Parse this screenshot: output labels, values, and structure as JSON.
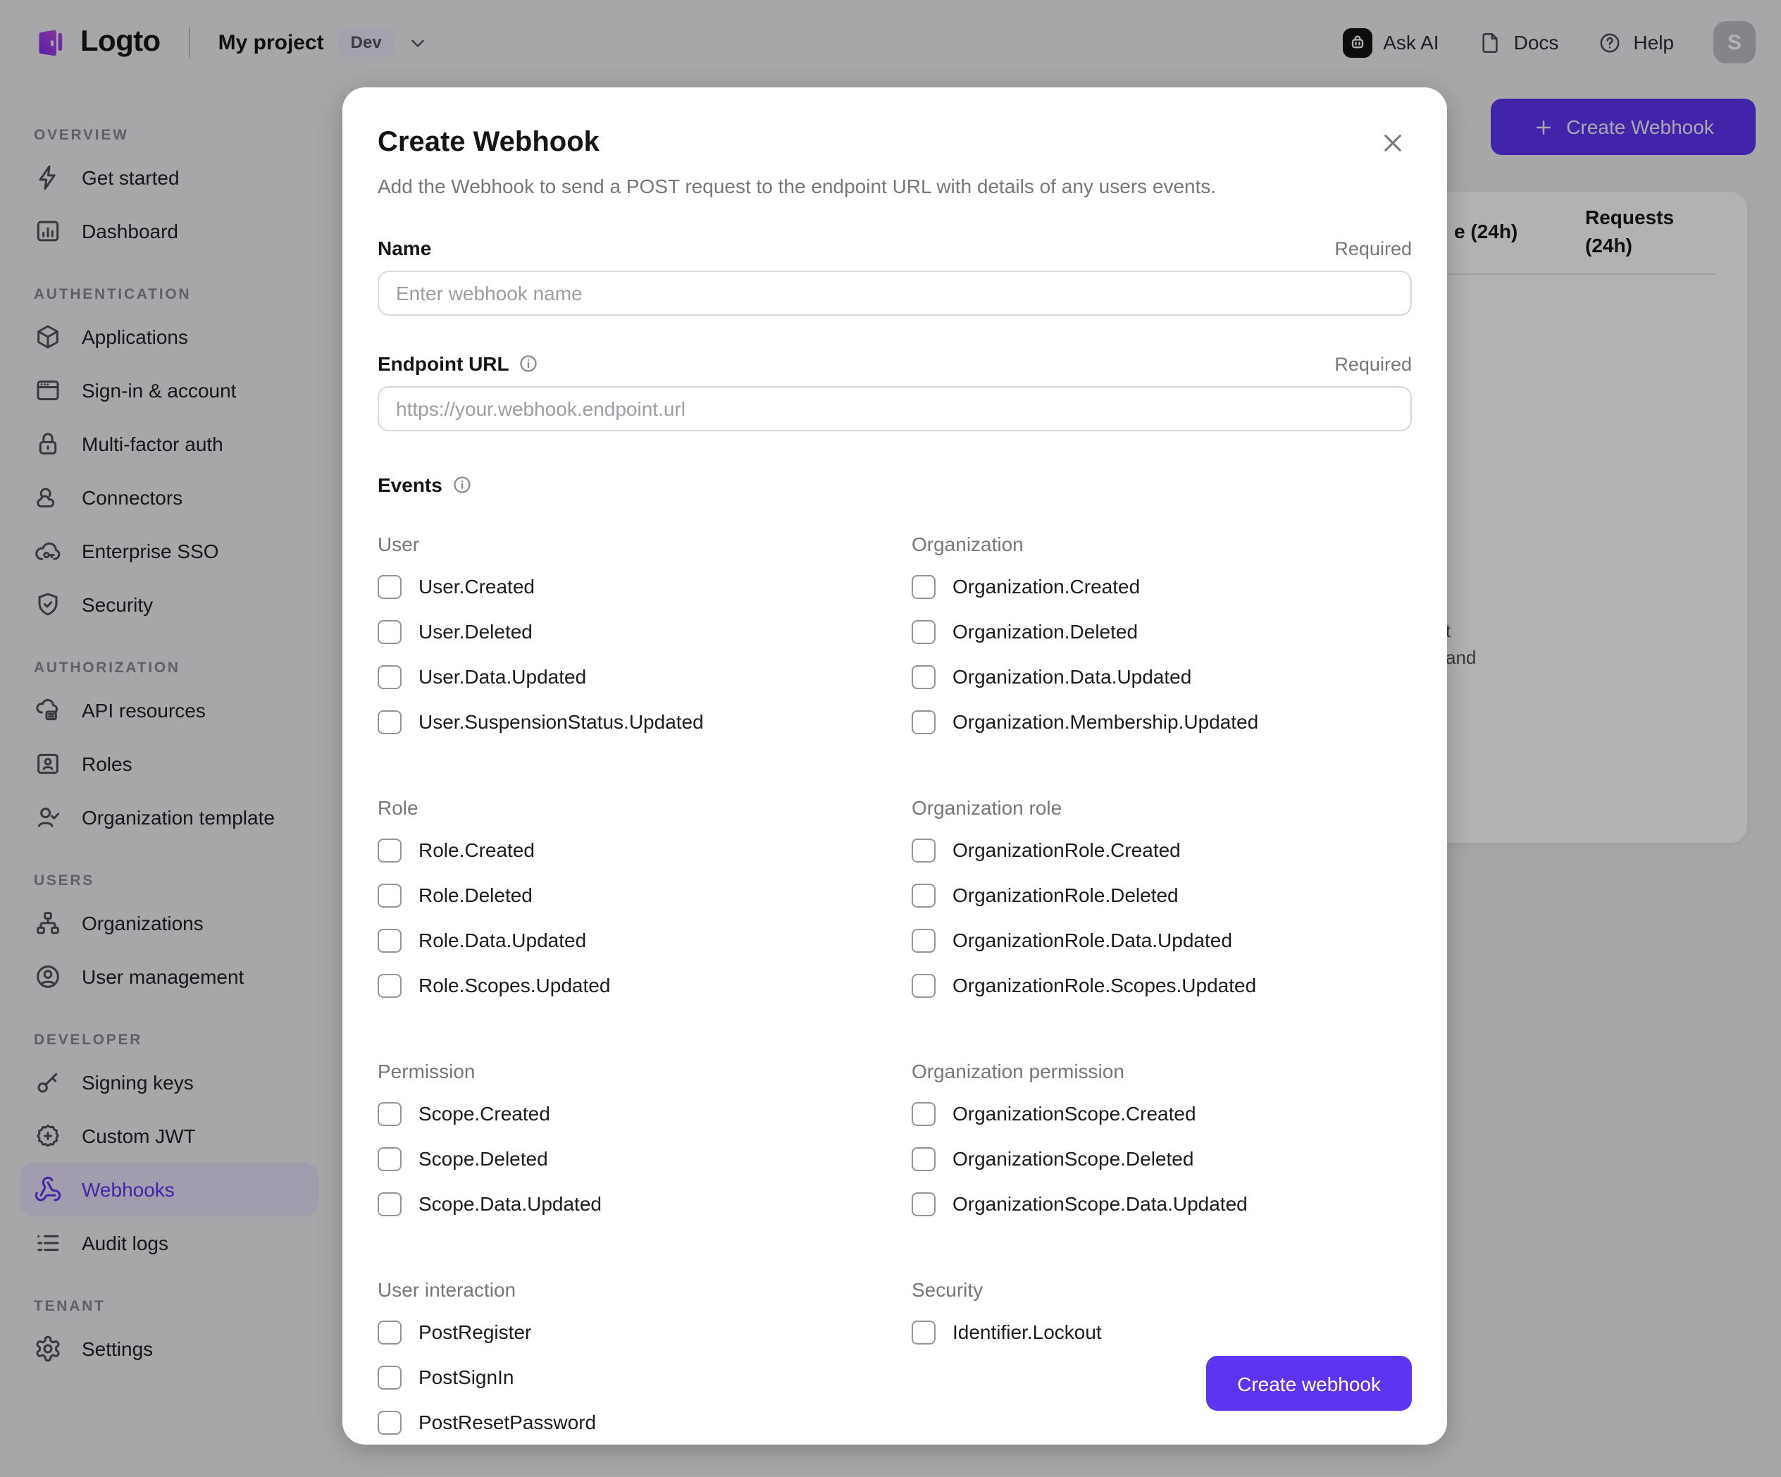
{
  "header": {
    "brand": "Logto",
    "project": "My project",
    "badge": "Dev",
    "ask_ai": "Ask AI",
    "docs": "Docs",
    "help": "Help",
    "avatar_initial": "S"
  },
  "colors": {
    "accent": "#5d34f2",
    "active_item_bg": "#e7e0fa",
    "overlay": "rgba(0,0,0,0.30)"
  },
  "sidebar": {
    "sections": [
      {
        "label": "OVERVIEW",
        "items": [
          {
            "label": "Get started",
            "icon": "lightning"
          },
          {
            "label": "Dashboard",
            "icon": "bar-chart"
          }
        ]
      },
      {
        "label": "AUTHENTICATION",
        "items": [
          {
            "label": "Applications",
            "icon": "cube"
          },
          {
            "label": "Sign-in & account",
            "icon": "window"
          },
          {
            "label": "Multi-factor auth",
            "icon": "lock"
          },
          {
            "label": "Connectors",
            "icon": "connectors"
          },
          {
            "label": "Enterprise SSO",
            "icon": "cloud-key"
          },
          {
            "label": "Security",
            "icon": "shield-check"
          }
        ]
      },
      {
        "label": "AUTHORIZATION",
        "items": [
          {
            "label": "API resources",
            "icon": "cloud-stack"
          },
          {
            "label": "Roles",
            "icon": "id-card"
          },
          {
            "label": "Organization template",
            "icon": "user-check"
          }
        ]
      },
      {
        "label": "USERS",
        "items": [
          {
            "label": "Organizations",
            "icon": "org-chart"
          },
          {
            "label": "User management",
            "icon": "user-circle"
          }
        ]
      },
      {
        "label": "DEVELOPER",
        "items": [
          {
            "label": "Signing keys",
            "icon": "key"
          },
          {
            "label": "Custom JWT",
            "icon": "seal"
          },
          {
            "label": "Webhooks",
            "icon": "webhook",
            "active": true
          },
          {
            "label": "Audit logs",
            "icon": "list"
          }
        ]
      },
      {
        "label": "TENANT",
        "items": [
          {
            "label": "Settings",
            "icon": "gear"
          }
        ]
      }
    ]
  },
  "background": {
    "create_button_label": "Create Webhook",
    "table": {
      "col1_fragment": "e (24h)",
      "col2_line1": "Requests",
      "col2_line2": "(24h)"
    },
    "empty_text_fragments": {
      "line1": "t",
      "line2": "and"
    }
  },
  "modal": {
    "title": "Create Webhook",
    "description": "Add the Webhook to send a POST request to the endpoint URL with details of any users events.",
    "name_field": {
      "label": "Name",
      "required_label": "Required",
      "placeholder": "Enter webhook name"
    },
    "endpoint_field": {
      "label": "Endpoint URL",
      "required_label": "Required",
      "placeholder": "https://your.webhook.endpoint.url"
    },
    "events_label": "Events",
    "event_groups": [
      {
        "title": "User",
        "items": [
          {
            "label": "User.Created"
          },
          {
            "label": "User.Deleted"
          },
          {
            "label": "User.Data.Updated"
          },
          {
            "label": "User.SuspensionStatus.Updated"
          }
        ]
      },
      {
        "title": "Organization",
        "items": [
          {
            "label": "Organization.Created"
          },
          {
            "label": "Organization.Deleted"
          },
          {
            "label": "Organization.Data.Updated"
          },
          {
            "label": "Organization.Membership.Updated"
          }
        ]
      },
      {
        "title": "Role",
        "items": [
          {
            "label": "Role.Created"
          },
          {
            "label": "Role.Deleted"
          },
          {
            "label": "Role.Data.Updated"
          },
          {
            "label": "Role.Scopes.Updated"
          }
        ]
      },
      {
        "title": "Organization role",
        "items": [
          {
            "label": "OrganizationRole.Created"
          },
          {
            "label": "OrganizationRole.Deleted"
          },
          {
            "label": "OrganizationRole.Data.Updated"
          },
          {
            "label": "OrganizationRole.Scopes.Updated"
          }
        ]
      },
      {
        "title": "Permission",
        "items": [
          {
            "label": "Scope.Created"
          },
          {
            "label": "Scope.Deleted"
          },
          {
            "label": "Scope.Data.Updated"
          }
        ]
      },
      {
        "title": "Organization permission",
        "items": [
          {
            "label": "OrganizationScope.Created"
          },
          {
            "label": "OrganizationScope.Deleted"
          },
          {
            "label": "OrganizationScope.Data.Updated"
          }
        ]
      },
      {
        "title": "User interaction",
        "items": [
          {
            "label": "PostRegister"
          },
          {
            "label": "PostSignIn"
          },
          {
            "label": "PostResetPassword"
          }
        ]
      },
      {
        "title": "Security",
        "items": [
          {
            "label": "Identifier.Lockout"
          }
        ]
      }
    ],
    "submit_label": "Create webhook"
  }
}
